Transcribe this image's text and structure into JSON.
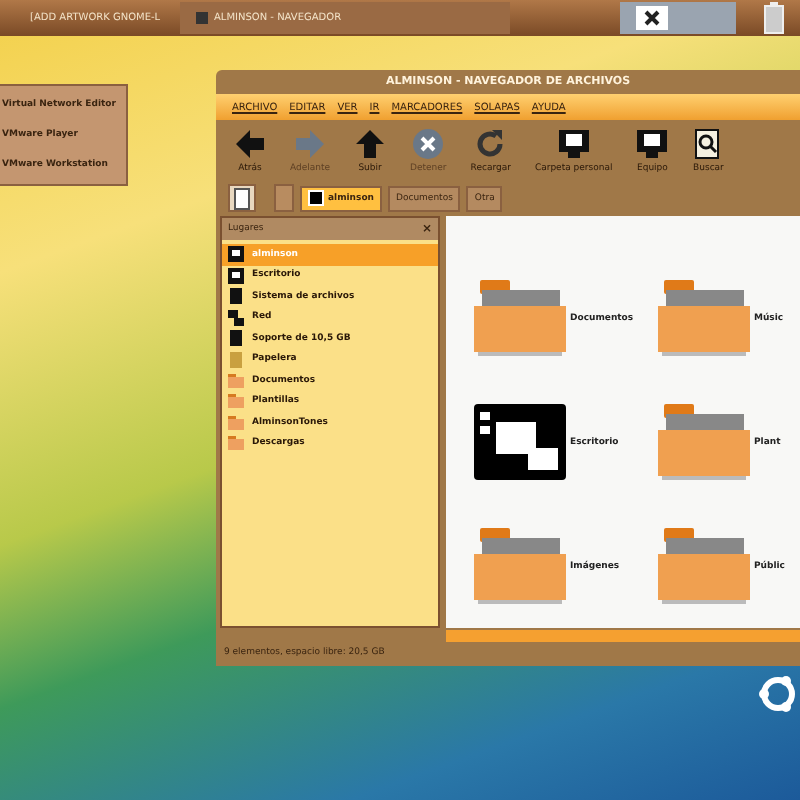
{
  "top_panel": {
    "tasks": [
      {
        "label": "[ADD ARTWORK GNOME-L",
        "selected": false
      },
      {
        "label": "ALMINSON - NAVEGADOR",
        "selected": true
      }
    ]
  },
  "desktop_menu": {
    "items": [
      "Virtual Network Editor",
      "VMware Player",
      "VMware Workstation"
    ]
  },
  "window": {
    "title": "ALMINSON - NAVEGADOR DE ARCHIVOS",
    "menu": [
      "ARCHIVO",
      "EDITAR",
      "VER",
      "IR",
      "MARCADORES",
      "SOLAPAS",
      "AYUDA"
    ],
    "toolbar": [
      {
        "kind": "back",
        "label": "Atrás",
        "disabled": false
      },
      {
        "kind": "forward",
        "label": "Adelante",
        "disabled": true
      },
      {
        "kind": "up",
        "label": "Subir",
        "disabled": false
      },
      {
        "kind": "stop",
        "label": "Detener",
        "disabled": true
      },
      {
        "kind": "reload",
        "label": "Recargar",
        "disabled": false
      },
      {
        "kind": "home",
        "label": "Carpeta personal",
        "disabled": false
      },
      {
        "kind": "computer",
        "label": "Equipo",
        "disabled": false
      },
      {
        "kind": "search",
        "label": "Buscar",
        "disabled": false
      }
    ],
    "path": [
      {
        "label": "alminson",
        "selected": true
      },
      {
        "label": "Documentos",
        "selected": false
      },
      {
        "label": "Otra",
        "selected": false
      }
    ],
    "sidebar": {
      "title": "Lugares",
      "close": "×",
      "items": [
        {
          "kind": "home",
          "label": "alminson",
          "selected": true
        },
        {
          "kind": "desktop",
          "label": "Escritorio",
          "selected": false
        },
        {
          "kind": "drive",
          "label": "Sistema de archivos",
          "selected": false
        },
        {
          "kind": "network",
          "label": "Red",
          "selected": false
        },
        {
          "kind": "drive",
          "label": "Soporte de 10,5 GB",
          "selected": false
        },
        {
          "kind": "trash",
          "label": "Papelera",
          "selected": false
        },
        {
          "kind": "folder",
          "label": "Documentos",
          "selected": false
        },
        {
          "kind": "folder",
          "label": "Plantillas",
          "selected": false
        },
        {
          "kind": "folder",
          "label": "AlminsonTones",
          "selected": false
        },
        {
          "kind": "folder",
          "label": "Descargas",
          "selected": false
        }
      ]
    },
    "files": [
      {
        "kind": "folder",
        "label": "Documentos"
      },
      {
        "kind": "folder",
        "label": "Músic"
      },
      {
        "kind": "desktop",
        "label": "Escritorio"
      },
      {
        "kind": "folder",
        "label": "Plant"
      },
      {
        "kind": "folder",
        "label": "Imágenes"
      },
      {
        "kind": "folder",
        "label": "Públic"
      }
    ],
    "status_bar": "9 elementos, espacio libre: 20,5 GB"
  }
}
